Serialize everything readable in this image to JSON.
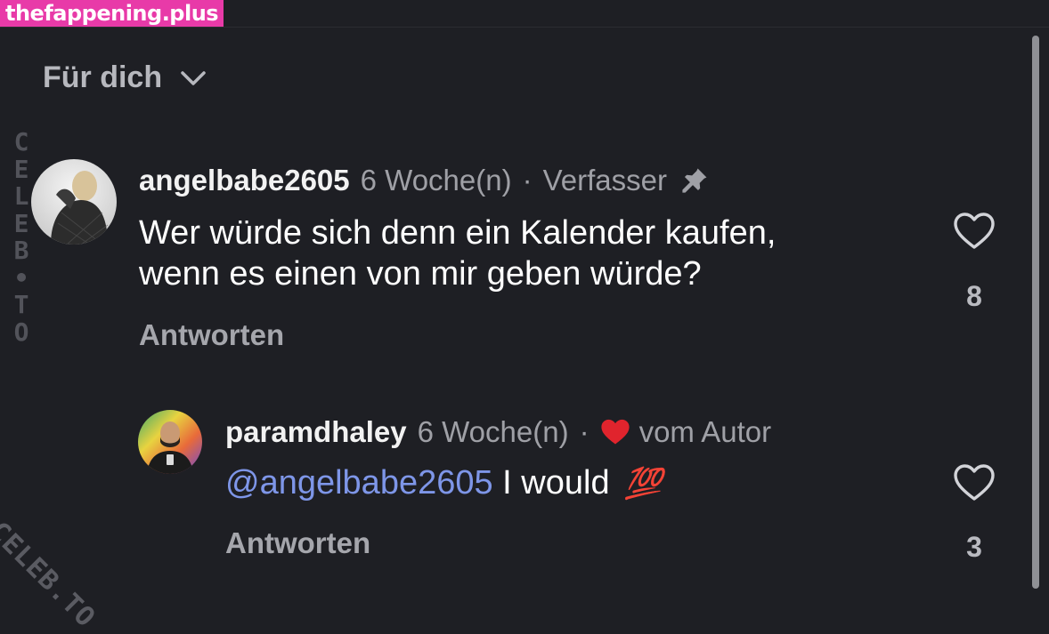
{
  "watermark": {
    "top": "thefappening.plus",
    "side": [
      "C",
      "E",
      "L",
      "E",
      "B",
      "•",
      "T",
      "O"
    ],
    "diagonal": "CELEB.TO"
  },
  "header": {
    "feed_label": "Für dich",
    "chevron_icon": "chevron-down-icon"
  },
  "comments": [
    {
      "username": "angelbabe2605",
      "time": "6 Woche(n)",
      "separator": "·",
      "role": "Verfasser",
      "pin_icon": "pin-icon",
      "text_line1": "Wer würde sich denn ein Kalender kaufen,",
      "text_line2": "wenn es einen von mir geben würde?",
      "reply_label": "Antworten",
      "likes": "8"
    },
    {
      "username": "paramdhaley",
      "time": "6 Woche(n)",
      "separator": "·",
      "liked_by": "vom Autor",
      "mention": "@angelbabe2605",
      "text": " I would ",
      "emoji": "💯",
      "reply_label": "Antworten",
      "likes": "3"
    }
  ],
  "colors": {
    "background": "#1e1f24",
    "mention": "#7e96e8",
    "author_heart": "#e0242d",
    "watermark_pink": "#e83aa8"
  }
}
